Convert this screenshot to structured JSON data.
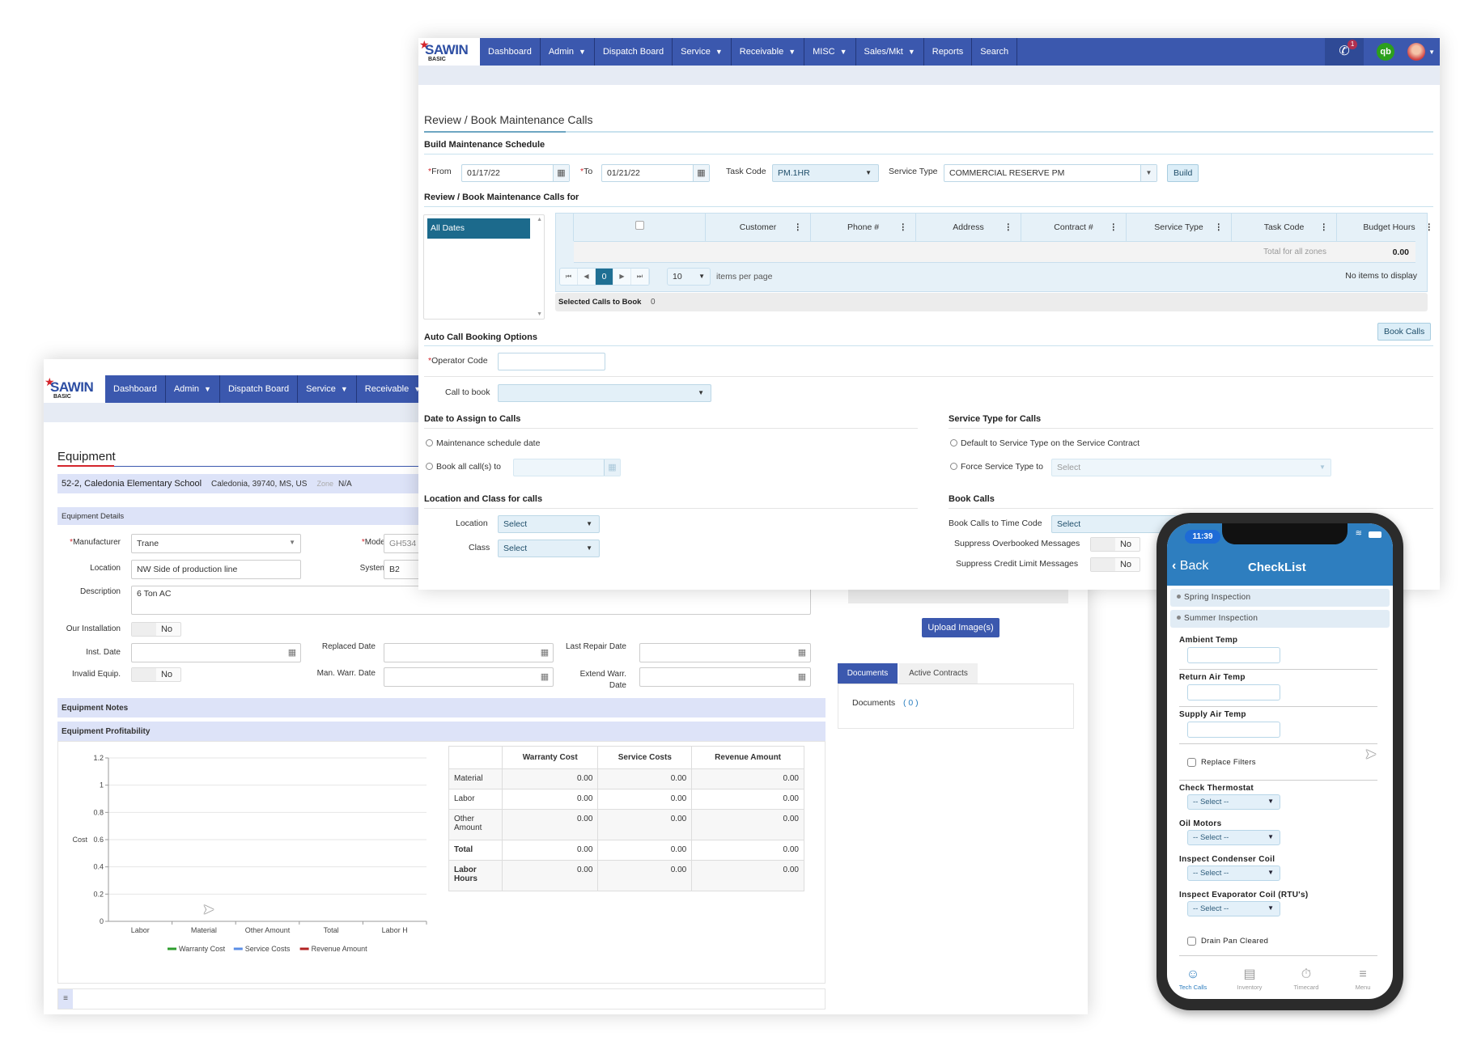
{
  "nav": {
    "logo_text": "SAWIN",
    "logo_sub": "BASIC",
    "items": [
      {
        "label": "Dashboard",
        "dropdown": false
      },
      {
        "label": "Admin",
        "dropdown": true
      },
      {
        "label": "Dispatch Board",
        "dropdown": false
      },
      {
        "label": "Service",
        "dropdown": true
      },
      {
        "label": "Receivable",
        "dropdown": true
      },
      {
        "label": "MISC",
        "dropdown": true
      },
      {
        "label": "Sales/Mkt",
        "dropdown": true
      },
      {
        "label": "Reports",
        "dropdown": false
      },
      {
        "label": "Search",
        "dropdown": false
      }
    ],
    "phone_badge": "1",
    "qb_label": "qb",
    "caret": "▼"
  },
  "review": {
    "title": "Review / Book Maintenance Calls",
    "build_section": "Build Maintenance Schedule",
    "from_label": "From",
    "from_value": "01/17/22",
    "to_label": "To",
    "to_value": "01/21/22",
    "task_code_label": "Task Code",
    "task_code_value": "PM.1HR",
    "service_type_label": "Service Type",
    "service_type_value": "COMMERCIAL RESERVE PM",
    "build_button": "Build",
    "calls_for_section": "Review / Book Maintenance Calls for",
    "date_list": [
      "All Dates"
    ],
    "grid": {
      "columns": [
        "Customer",
        "Phone #",
        "Address",
        "Contract #",
        "Service Type",
        "Task Code",
        "Budget Hours"
      ],
      "total_label": "Total for all zones",
      "total_value": "0.00",
      "current_page": "0",
      "page_size": "10",
      "items_per_page_label": "items per page",
      "empty_message": "No items to display"
    },
    "selected_calls_label": "Selected Calls to Book",
    "selected_calls_value": "0",
    "book_calls_button": "Book Calls",
    "auto_section": "Auto Call Booking Options",
    "operator_code_label": "Operator Code",
    "operator_code_value": "",
    "call_to_book_label": "Call to book",
    "call_to_book_value": "",
    "date_assign_section": "Date to Assign to Calls",
    "date_option_1": "Maintenance schedule date",
    "date_option_2": "Book all call(s) to",
    "service_type_section": "Service Type for Calls",
    "st_option_1": "Default to Service Type on the Service Contract",
    "st_option_2": "Force Service Type to",
    "force_service_type_placeholder": "Select",
    "location_class_section": "Location and Class for calls",
    "location_label": "Location",
    "location_value": "Select",
    "class_label": "Class",
    "class_value": "Select",
    "book_calls_section": "Book Calls",
    "time_code_label": "Book Calls to Time Code",
    "time_code_value": "Select",
    "suppress_overbooked_label": "Suppress Overbooked Messages",
    "suppress_overbooked_value": "No",
    "suppress_credit_label": "Suppress Credit Limit Messages",
    "suppress_credit_value": "No"
  },
  "equipment": {
    "title": "Equipment",
    "customer": "52-2, Caledonia Elementary School",
    "address": "Caledonia, 39740, MS, US",
    "zone_label": "Zone",
    "zone_value": "N/A",
    "details_band": "Equipment Details",
    "manufacturer_label": "Manufacturer",
    "manufacturer_value": "Trane",
    "model_label": "Model",
    "model_value": "GH534",
    "location_label": "Location",
    "location_value": "NW Side of production line",
    "system_label": "System",
    "system_value": "B2",
    "description_label": "Description",
    "description_value": "6 Ton AC",
    "our_installation_label": "Our Installation",
    "our_installation_value": "No",
    "inst_date_label": "Inst. Date",
    "replaced_date_label": "Replaced Date",
    "last_repair_date_label": "Last Repair Date",
    "invalid_equip_label": "Invalid Equip.",
    "invalid_equip_value": "No",
    "man_warr_label": "Man. Warr. Date",
    "extend_warr_label": "Extend Warr. Date",
    "upload_button": "Upload Image(s)",
    "tabs": [
      {
        "label": "Documents",
        "active": true
      },
      {
        "label": "Active Contracts",
        "active": false
      }
    ],
    "documents_label": "Documents",
    "documents_count": "0",
    "notes_band": "Equipment Notes",
    "profit_band": "Equipment Profitability",
    "table": {
      "headers": [
        "",
        "Warranty Cost",
        "Service Costs",
        "Revenue Amount"
      ],
      "rows": [
        {
          "label": "Material",
          "bold": false,
          "values": [
            "0.00",
            "0.00",
            "0.00"
          ]
        },
        {
          "label": "Labor",
          "bold": false,
          "values": [
            "0.00",
            "0.00",
            "0.00"
          ]
        },
        {
          "label": "Other Amount",
          "bold": false,
          "values": [
            "0.00",
            "0.00",
            "0.00"
          ]
        },
        {
          "label": "Total",
          "bold": true,
          "values": [
            "0.00",
            "0.00",
            "0.00"
          ]
        },
        {
          "label": "Labor Hours",
          "bold": true,
          "values": [
            "0.00",
            "0.00",
            "0.00"
          ]
        }
      ]
    }
  },
  "chart_data": {
    "type": "line",
    "title": "",
    "xlabel": "",
    "ylabel": "Cost",
    "categories": [
      "Labor",
      "Material",
      "Other Amount",
      "Total",
      "Labor H"
    ],
    "ylim": [
      0,
      1.2
    ],
    "yticks": [
      "0",
      "0.2",
      "0.4",
      "0.6",
      "0.8",
      "1",
      "1.2"
    ],
    "grid": true,
    "legend": "bottom",
    "series": [
      {
        "name": "Warranty Cost",
        "color": "#2e9e2e",
        "values": [
          0,
          0,
          0,
          0,
          0
        ]
      },
      {
        "name": "Service Costs",
        "color": "#5b8ee6",
        "values": [
          0,
          0,
          0,
          0,
          0
        ]
      },
      {
        "name": "Revenue Amount",
        "color": "#b22222",
        "values": [
          0,
          0,
          0,
          0,
          0
        ]
      }
    ]
  },
  "phone": {
    "time": "11:39",
    "back_label": "Back",
    "title": "CheckList",
    "sections": [
      "Spring Inspection",
      "Summer Inspection"
    ],
    "fields": {
      "ambient_temp": "Ambient Temp",
      "return_air_temp": "Return Air Temp",
      "supply_air_temp": "Supply Air Temp",
      "replace_filters": "Replace Filters",
      "check_thermostat": "Check Thermostat",
      "oil_motors": "Oil Motors",
      "inspect_condenser": "Inspect Condenser Coil",
      "inspect_evaporator": "Inspect Evaporator Coil (RTU's)",
      "drain_pan": "Drain Pan Cleared"
    },
    "select_placeholder": "-- Select --",
    "tabs": [
      {
        "label": "Tech Calls",
        "active": true
      },
      {
        "label": "Inventory",
        "active": false
      },
      {
        "label": "Timecard",
        "active": false
      },
      {
        "label": "Menu",
        "active": false
      }
    ]
  },
  "colors": {
    "nav_blue": "#3b58ae",
    "accent_teal": "#1c6a8c",
    "phone_blue": "#2e7ebf",
    "required_red": "#d4252c"
  }
}
